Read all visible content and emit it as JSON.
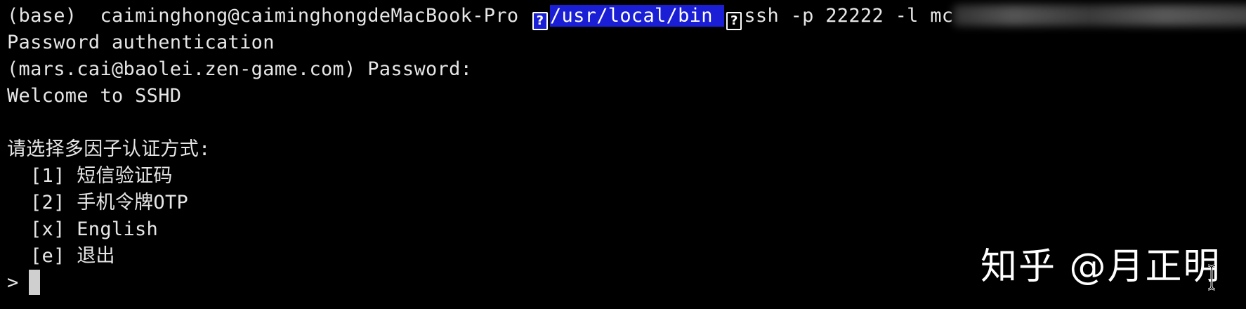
{
  "terminal": {
    "prompt_prefix": "(base)  caiminghong@caiminghongdeMacBook-Pro ",
    "prompt_path": "/usr/local/bin ",
    "glyph": "?",
    "command": "ssh -p 22222 -l mc",
    "line_password_auth": "Password authentication",
    "line_password_prompt": "(mars.cai@baolei.zen-game.com) Password:",
    "line_welcome": "Welcome to SSHD",
    "line_blank": "",
    "mfa_prompt": "请选择多因子认证方式:",
    "options": [
      {
        "label": "[1] 短信验证码"
      },
      {
        "label": "[2] 手机令牌OTP"
      },
      {
        "label": "[x] English"
      },
      {
        "label": "[e] 退出"
      }
    ],
    "input_prompt": ">"
  },
  "watermark": {
    "text": "知乎 @月正明"
  },
  "colors": {
    "background": "#000000",
    "foreground": "#e6e6e6",
    "path_highlight": "#1a1fd6",
    "cursor": "#cfcfcf"
  },
  "icons": {
    "unknown_glyph": "question-box-icon",
    "mouse_pointer": "ibeam-cursor-icon"
  }
}
